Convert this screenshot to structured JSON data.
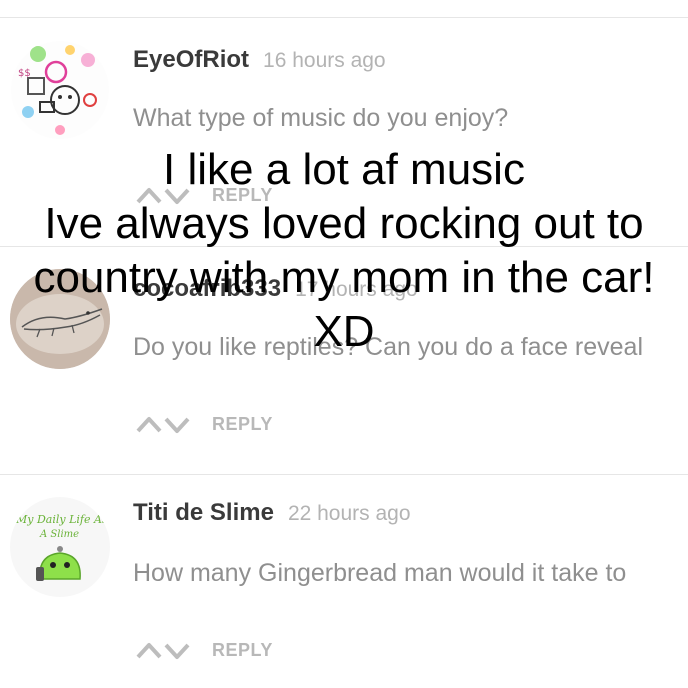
{
  "comments": [
    {
      "username": "EyeOfRiot",
      "time": "16 hours ago",
      "text": "What type of music do you enjoy?",
      "reply_label": "REPLY",
      "avatar_icon": "doodle-avatar-icon"
    },
    {
      "username": "cocoafrib333",
      "time": "17 hours ago",
      "text": "Do you like reptiles? Can you do a face reveal",
      "reply_label": "REPLY",
      "avatar_icon": "alligator-sketch-avatar-icon"
    },
    {
      "username": "Titi de Slime",
      "time": "22 hours ago",
      "text": "How many Gingerbread man would it take to",
      "reply_label": "REPLY",
      "avatar_icon": "slime-avatar-icon"
    }
  ],
  "overlay": {
    "lines": [
      "I like a lot af music",
      "Ive always loved rocking out to",
      "country with my mom in the car!",
      "XD"
    ]
  },
  "colors": {
    "username": "#3a3a3a",
    "timestamp": "#b3b3b3",
    "comment_text": "#8f8f8f",
    "reply": "#b8b8b8",
    "divider": "#e6e6e6",
    "slime_green": "#8ee04a"
  }
}
